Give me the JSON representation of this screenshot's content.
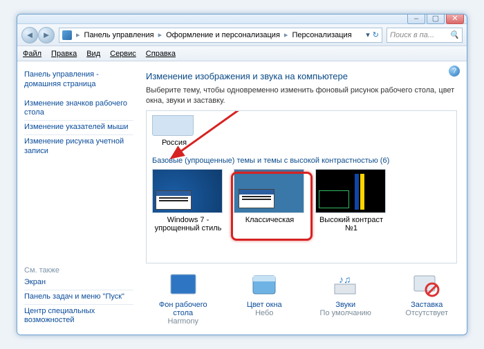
{
  "window_controls": {
    "min": "–",
    "max": "▢",
    "close": "✕"
  },
  "address": {
    "root": "Панель управления",
    "mid": "Оформление и персонализация",
    "leaf": "Персонализация"
  },
  "search": {
    "placeholder": "Поиск в па..."
  },
  "menu": {
    "file": "Файл",
    "edit": "Правка",
    "view": "Вид",
    "tools": "Сервис",
    "help": "Справка"
  },
  "sidebar": {
    "home": "Панель управления - домашняя страница",
    "icons": "Изменение значков рабочего стола",
    "pointers": "Изменение указателей мыши",
    "account_pic": "Изменение рисунка учетной записи",
    "see_also": "См. также",
    "screen": "Экран",
    "taskbar": "Панель задач и меню \"Пуск\"",
    "ease": "Центр специальных возможностей"
  },
  "content": {
    "title": "Изменение изображения и звука на компьютере",
    "subtitle": "Выберите тему, чтобы одновременно изменить фоновый рисунок рабочего стола, цвет окна, звуки и заставку.",
    "theme_top_label": "Россия",
    "basic_header": "Базовые (упрощенные) темы и темы с высокой контрастностью (6)",
    "themes": [
      {
        "label": "Windows 7 - упрощенный стиль"
      },
      {
        "label": "Классическая"
      },
      {
        "label": "Высокий контраст №1"
      }
    ]
  },
  "bottom": {
    "bg": {
      "title": "Фон рабочего стола",
      "value": "Harmony"
    },
    "color": {
      "title": "Цвет окна",
      "value": "Небо"
    },
    "sound": {
      "title": "Звуки",
      "value": "По умолчанию"
    },
    "saver": {
      "title": "Заставка",
      "value": "Отсутствует"
    }
  }
}
